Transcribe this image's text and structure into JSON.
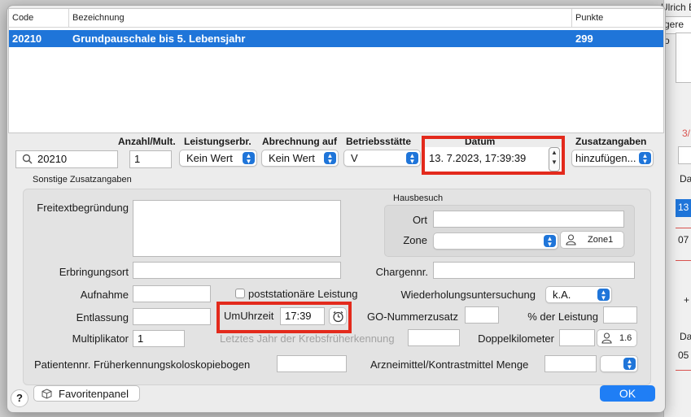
{
  "background": {
    "top_text": "Ulrich BA",
    "fragment_1": "gere",
    "fragment_2": "o",
    "fragment_3": "3/",
    "fragment_4": "Da",
    "fragment_5": "13",
    "fragment_6": "07",
    "fragment_7": "+",
    "fragment_8": "Da",
    "fragment_9": "05"
  },
  "table": {
    "columns": [
      "Code",
      "Bezeichnung",
      "Punkte"
    ],
    "rows": [
      {
        "code": "20210",
        "bezeichnung": "Grundpauschale bis 5. Lebensjahr",
        "punkte": "299"
      }
    ]
  },
  "form_header": {
    "anzahl": "Anzahl/Mult.",
    "leistungserbr": "Leistungserbr.",
    "abrechnung": "Abrechnung auf",
    "betriebsstaette": "Betriebsstätte",
    "datum": "Datum",
    "zusatzangaben": "Zusatzangaben"
  },
  "form": {
    "search_value": "20210",
    "anzahl_value": "1",
    "leistungserbr_value": "Kein Wert",
    "abrechnung_value": "Kein Wert",
    "betriebsstaette_value": "V",
    "datum_value": "13.  7.2023, 17:39:39",
    "zusatzangaben_value": "hinzufügen..."
  },
  "sonstige": {
    "title": "Sonstige Zusatzangaben",
    "freitext_label": "Freitextbegründung",
    "hausbesuch_title": "Hausbesuch",
    "ort_label": "Ort",
    "zone_label": "Zone",
    "zone_button": "Zone1",
    "erbringungsort_label": "Erbringungsort",
    "chargennr_label": "Chargennr.",
    "aufnahme_label": "Aufnahme",
    "poststationaer_label": "poststationäre Leistung",
    "wiederholung_label": "Wiederholungsuntersuchung",
    "wiederholung_value": "k.A.",
    "entlassung_label": "Entlassung",
    "umuhrzeit_label": "UmUhrzeit",
    "umuhrzeit_value": "17:39",
    "go_nummer_label": "GO-Nummerzusatz",
    "prozent_label": "% der Leistung",
    "multiplikator_label": "Multiplikator",
    "multiplikator_value": "1",
    "krebs_label": "Letztes Jahr der Krebsfrüherkennung",
    "doppelkm_label": "Doppelkilometer",
    "doppelkm_button": "1.6",
    "patientennr_label": "Patientennr. Früherkennungskoloskopiebogen",
    "arzneimittel_label": "Arzneimittel/Kontrastmittel Menge"
  },
  "footer": {
    "help": "?",
    "favoritenpanel": "Favoritenpanel",
    "ok": "OK"
  },
  "colors": {
    "selection": "#1f75d9",
    "highlight_box": "#e32a1c",
    "ok_button": "#1f7ef5"
  }
}
